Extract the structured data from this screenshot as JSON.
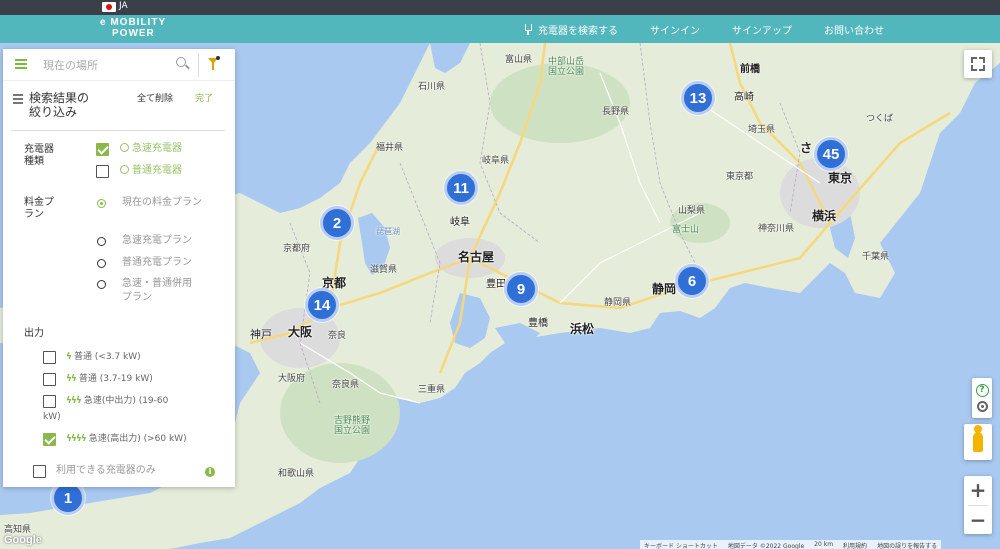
{
  "lang_bar": {
    "language": "JA"
  },
  "header": {
    "logo_line1": "e MOBILITY",
    "logo_line2": "POWER",
    "nav": [
      {
        "label": "充電器を検索する",
        "icon": "plug-icon"
      },
      {
        "label": "サインイン"
      },
      {
        "label": "サインアップ"
      },
      {
        "label": "お問い合わせ"
      }
    ]
  },
  "search": {
    "placeholder": "現在の場所",
    "value": ""
  },
  "filter": {
    "title_line1": "検索結果の",
    "title_line2": "絞り込み",
    "clear_all": "全て削除",
    "done": "完了",
    "charger_type": {
      "label_line1": "充電器",
      "label_line2": "種類",
      "options": [
        {
          "label": "急速充電器",
          "checked": true
        },
        {
          "label": "普通充電器",
          "checked": false
        }
      ]
    },
    "price_plan": {
      "label_line1": "料金プ",
      "label_line2": "ラン",
      "options": [
        {
          "label": "現在の料金プラン",
          "selected": true
        },
        {
          "label": "急速充電プラン",
          "selected": false
        },
        {
          "label": "普通充電プラン",
          "selected": false
        },
        {
          "label_line1": "急速・普通併用",
          "label_line2": "プラン",
          "selected": false
        }
      ]
    },
    "output": {
      "label": "出力",
      "options": [
        {
          "bolts": "ϟ",
          "label": "普通 (<3.7 kW)",
          "checked": false
        },
        {
          "bolts": "ϟϟ",
          "label": "普通 (3.7-19 kW)",
          "checked": false
        },
        {
          "bolts": "ϟϟϟ",
          "label": "急速(中出力) (19-60",
          "label_line2": "kW)",
          "checked": false
        },
        {
          "bolts": "ϟϟϟϟ",
          "label": "急速(高出力) (>60 kW)",
          "checked": true
        }
      ]
    },
    "available_only": {
      "label": "利用できる充電器のみ",
      "checked": false
    }
  },
  "map": {
    "clusters": [
      {
        "count": "13"
      },
      {
        "count": "45"
      },
      {
        "count": "11"
      },
      {
        "count": "2"
      },
      {
        "count": "14"
      },
      {
        "count": "9"
      },
      {
        "count": "6"
      },
      {
        "count": "1"
      }
    ],
    "labels": {
      "ishikawa": "石川県",
      "toyama": "富山県",
      "nagano": "長野県",
      "gifu_ken": "岐阜県",
      "fukui": "福井県",
      "kyoto_fu": "京都府",
      "shiga": "滋賀県",
      "kyoto": "京都",
      "osaka": "大阪",
      "kobe": "神戸",
      "nara": "奈良",
      "nara_ken": "奈良県",
      "osaka_fu": "大阪府",
      "mie": "三重県",
      "wakayama": "和歌山県",
      "nagoya": "名古屋",
      "gifu": "岐阜",
      "toyota": "豊田",
      "toyohashi": "豊橋",
      "hamamatsu": "浜松",
      "shizuoka": "静岡",
      "shizuoka_ken": "静岡県",
      "yamanashi": "山梨県",
      "tokyo_to": "東京都",
      "tokyo": "東京",
      "yokohama": "横浜",
      "kanagawa": "神奈川県",
      "chiba": "千葉県",
      "saitama_ken": "埼玉県",
      "gunma": "群馬",
      "maebashi": "前橋",
      "takasaki": "高崎",
      "saitama": "さ",
      "fuji": "富士山",
      "kochi": "高知県",
      "chubu_park": "中部山岳\n国立公園",
      "yoshino_park": "吉野熊野\n国立公園",
      "biwa": "琵琶湖",
      "hakuba": "白山",
      "tsukuba": "つくば",
      "kumagaya": "熊谷"
    }
  },
  "attribution": {
    "shortcuts": "キーボード ショートカット",
    "data": "地図データ ©2022 Google",
    "scale": "20 km",
    "terms": "利用規約",
    "report": "地図の誤りを報告する"
  },
  "google": "Google",
  "colors": {
    "header": "#52b6bd",
    "accent": "#8ab84a",
    "cluster": "#2f6fd6"
  }
}
